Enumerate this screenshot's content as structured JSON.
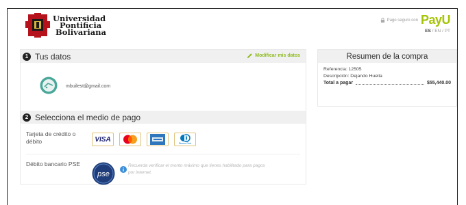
{
  "header": {
    "university_lines": [
      "Universidad",
      "Pontificia",
      "Bolivariana"
    ],
    "secure_text": "Pago seguro con",
    "payu_brand": "PayU",
    "languages": [
      "ES",
      "EN",
      "PT"
    ],
    "language_separator": "/"
  },
  "step1": {
    "number": "1",
    "title": "Tus datos",
    "modify_label": "Modificar mis datos",
    "email": "mbuilest@gmail.com"
  },
  "step2": {
    "number": "2",
    "title": "Selecciona el medio de pago",
    "card_label": "Tarjeta de crédito o débito",
    "cards": [
      "VISA",
      "Mastercard",
      "American Express",
      "Diners Club"
    ],
    "diners_caption": "Diners Club",
    "pse_label": "Débito bancario PSE",
    "pse_logo_text": "pse",
    "pse_note": "Recuerda verificar el monto máximo que tienes habilitado para pagos por internet."
  },
  "summary": {
    "title": "Resumen de la compra",
    "reference_label": "Referencia:",
    "reference_value": "12505",
    "description_label": "Descripción:",
    "description_value": "Dejando Huella",
    "total_label": "Total a pagar",
    "total_value": "$55,440.00"
  },
  "colors": {
    "payu_green": "#a6c307",
    "link_green": "#8dbb1f",
    "pse_blue": "#1f3d7a"
  }
}
